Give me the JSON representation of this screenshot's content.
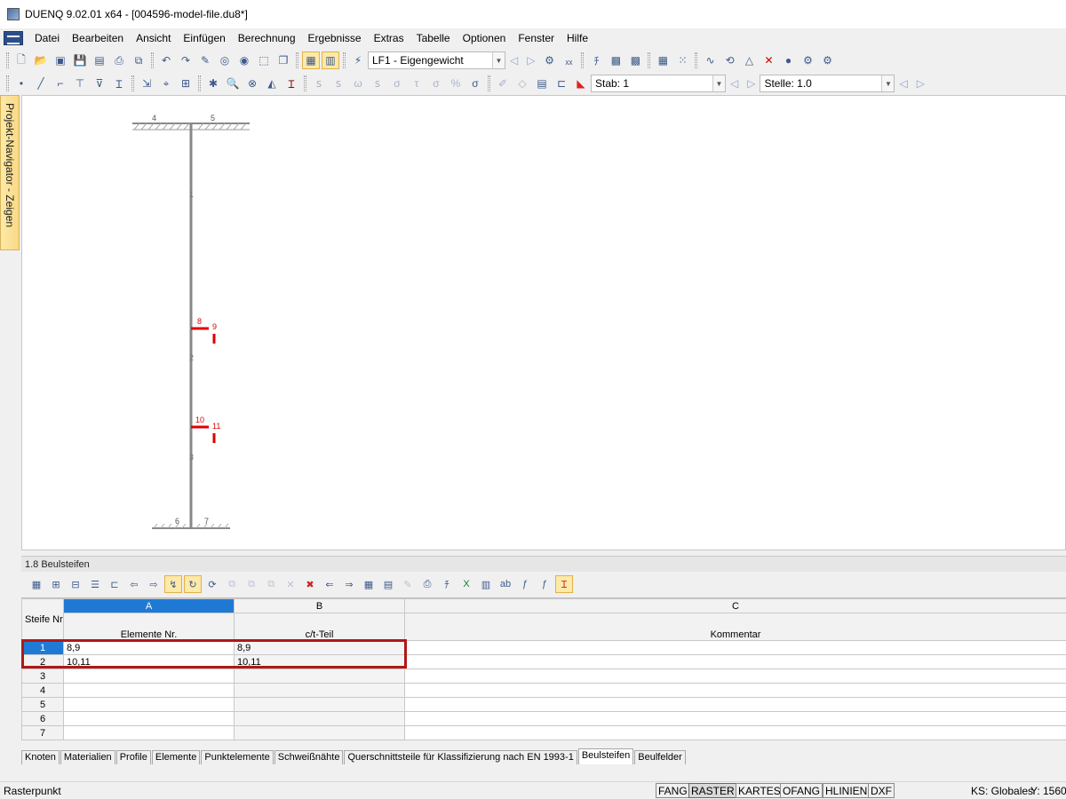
{
  "window": {
    "title": "DUENQ 9.02.01 x64 - [004596-model-file.du8*]"
  },
  "menu": {
    "items": [
      "Datei",
      "Bearbeiten",
      "Ansicht",
      "Einfügen",
      "Berechnung",
      "Ergebnisse",
      "Extras",
      "Tabelle",
      "Optionen",
      "Fenster",
      "Hilfe"
    ]
  },
  "toolbar": {
    "loadcase": "LF1 - Eigengewicht",
    "member": "Stab: 1",
    "location": "Stelle: 1.0"
  },
  "navigator": {
    "label": "Projekt-Navigator - Zeigen"
  },
  "model": {
    "node_labels": [
      "4",
      "5",
      "6",
      "7"
    ],
    "member_labels": [
      "1",
      "2",
      "3"
    ],
    "stiffener_labels": [
      "8",
      "9",
      "10",
      "11"
    ]
  },
  "panel": {
    "title": "1.8 Beulsteifen"
  },
  "table": {
    "header_row": "Steife Nr.",
    "col_letters": [
      "A",
      "B",
      "C"
    ],
    "columns": [
      "Elemente Nr.",
      "c/t-Teil",
      "Kommentar"
    ],
    "rows": [
      {
        "nr": "1",
        "a": "8,9",
        "b": "8,9",
        "c": ""
      },
      {
        "nr": "2",
        "a": "10,11",
        "b": "10,11",
        "c": ""
      },
      {
        "nr": "3",
        "a": "",
        "b": "",
        "c": ""
      },
      {
        "nr": "4",
        "a": "",
        "b": "",
        "c": ""
      },
      {
        "nr": "5",
        "a": "",
        "b": "",
        "c": ""
      },
      {
        "nr": "6",
        "a": "",
        "b": "",
        "c": ""
      },
      {
        "nr": "7",
        "a": "",
        "b": "",
        "c": ""
      }
    ]
  },
  "tabs": [
    "Knoten",
    "Materialien",
    "Profile",
    "Elemente",
    "Punktelemente",
    "Schweißnähte",
    "Querschnittsteile für Klassifizierung nach EN 1993-1",
    "Beulsteifen",
    "Beulfelder"
  ],
  "active_tab": "Beulsteifen",
  "status": {
    "text": "Rasterpunkt",
    "buttons": [
      "FANG",
      "RASTER",
      "KARTES",
      "OFANG",
      "HLINIEN",
      "DXF"
    ],
    "coord_system": "KS: Globales",
    "y_coord": "Y:  1560"
  },
  "colors": {
    "highlight": "#b01818",
    "selection": "#1f7ad6",
    "stiffener": "#e00000"
  }
}
